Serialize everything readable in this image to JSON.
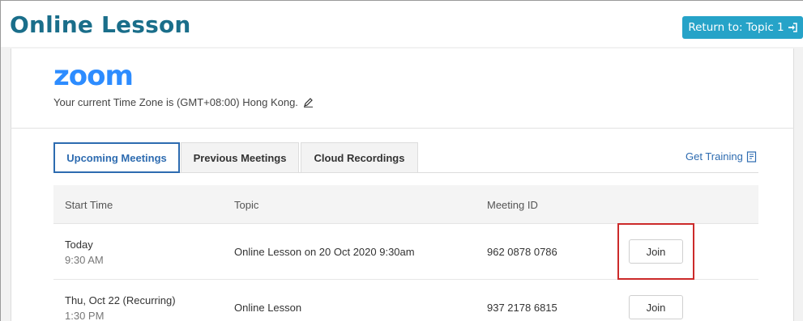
{
  "page": {
    "title": "Online Lesson",
    "return_button": "Return to: Topic 1"
  },
  "zoom": {
    "logo": "zoom",
    "timezone_text": "Your current Time Zone is (GMT+08:00) Hong Kong."
  },
  "tabs": [
    {
      "label": "Upcoming Meetings",
      "active": true
    },
    {
      "label": "Previous Meetings",
      "active": false
    },
    {
      "label": "Cloud Recordings",
      "active": false
    }
  ],
  "get_training": "Get Training",
  "table": {
    "headers": [
      "Start Time",
      "Topic",
      "Meeting ID"
    ],
    "rows": [
      {
        "date": "Today",
        "time": "9:30 AM",
        "topic": "Online Lesson on 20 Oct 2020 9:30am",
        "meeting_id": "962 0878 0786",
        "action": "Join"
      },
      {
        "date": "Thu, Oct 22 (Recurring)",
        "time": "1:30 PM",
        "topic": "Online Lesson",
        "meeting_id": "937 2178 6815",
        "action": "Join"
      }
    ]
  },
  "colors": {
    "title": "#1a6e8a",
    "return_button_bg": "#26a3c8",
    "zoom_blue": "#2d8cff",
    "link_blue": "#2d6bb0",
    "highlight": "#cc2a2a"
  },
  "icons": {
    "return": "sign-in-icon",
    "edit": "pencil-icon",
    "training": "book-icon"
  }
}
